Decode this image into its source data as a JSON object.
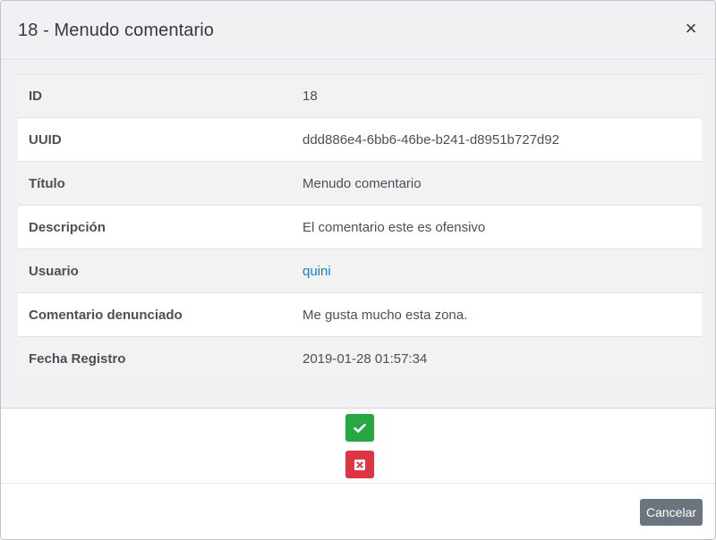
{
  "modal": {
    "title": "18 - Menudo comentario",
    "close_symbol": "×"
  },
  "details": {
    "rows": [
      {
        "label": "ID",
        "value": "18"
      },
      {
        "label": "UUID",
        "value": "ddd886e4-6bb6-46be-b241-d8951b727d92"
      },
      {
        "label": "Título",
        "value": "Menudo comentario"
      },
      {
        "label": "Descripción",
        "value": "El comentario este es ofensivo"
      },
      {
        "label": "Usuario",
        "value": "quini"
      },
      {
        "label": "Comentario denunciado",
        "value": "Me gusta mucho esta zona."
      },
      {
        "label": "Fecha Registro",
        "value": "2019-01-28 01:57:34"
      }
    ]
  },
  "actions": {
    "approve_icon": "check-icon",
    "reject_icon": "times-square-icon"
  },
  "footer": {
    "cancel_label": "Cancelar"
  },
  "colors": {
    "approve": "#28a745",
    "reject": "#dc3545",
    "cancel": "#6c757d",
    "link": "#1a7bd0"
  }
}
